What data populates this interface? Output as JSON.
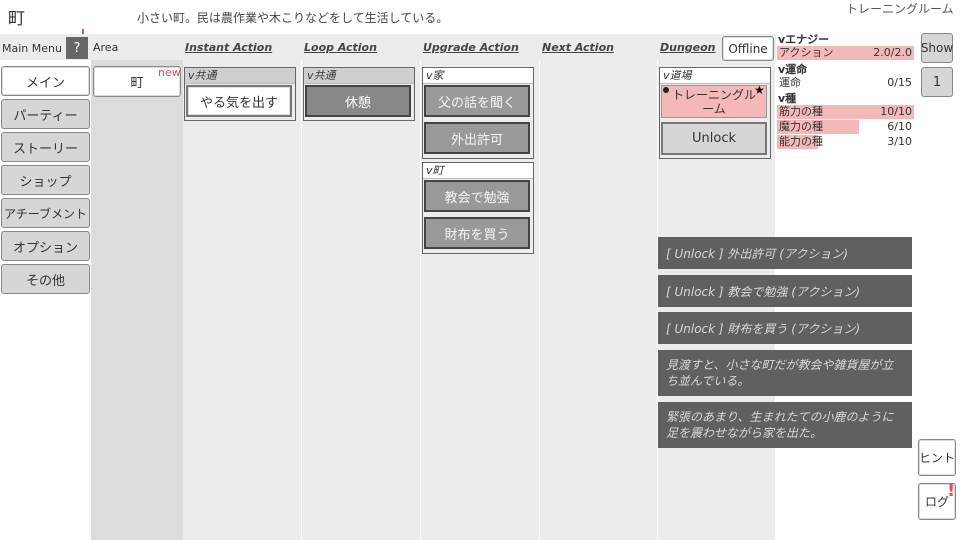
{
  "header": {
    "location": "町",
    "description": "小さい町。民は農作業や木こりなどをして生活している。",
    "current_area": "トレーニングルーム"
  },
  "columns": {
    "main_menu": "Main Menu",
    "help": "?",
    "area": "Area",
    "instant": "Instant Action",
    "loop": "Loop Action",
    "upgrade": "Upgrade Action",
    "next": "Next Action",
    "dungeon": "Dungeon",
    "offline": "Offline"
  },
  "menu": [
    "メイン",
    "パーティー",
    "ストーリー",
    "ショップ",
    "アチーブメント",
    "オプション",
    "その他"
  ],
  "area": {
    "town": "町",
    "new_badge": "new"
  },
  "instant": {
    "group": "共通",
    "items": [
      "やる気を出す"
    ]
  },
  "loop": {
    "group": "共通",
    "items": [
      "休憩"
    ]
  },
  "upgrade": {
    "home_group": "家",
    "home_items": [
      "父の話を聞く",
      "外出許可"
    ],
    "town_group": "町",
    "town_items": [
      "教会で勉強",
      "財布を買う"
    ]
  },
  "dungeon": {
    "group": "道場",
    "item": "トレーニングルーム",
    "unlock": "Unlock"
  },
  "stats": {
    "energy_head": "エナジー",
    "energy_rows": [
      {
        "label": "アクション",
        "value": "2.0/2.0",
        "fill": 1.0
      }
    ],
    "fate_head": "運命",
    "fate_rows": [
      {
        "label": "運命",
        "value": "0/15",
        "fill": 0.0
      }
    ],
    "seed_head": "種",
    "seed_rows": [
      {
        "label": "筋力の種",
        "value": "10/10",
        "fill": 1.0
      },
      {
        "label": "魔力の種",
        "value": "6/10",
        "fill": 0.6
      },
      {
        "label": "能力の種",
        "value": "3/10",
        "fill": 0.3
      }
    ]
  },
  "side": {
    "show": "Show",
    "page": "1",
    "hint": "ヒント",
    "log": "ログ",
    "log_badge": "!"
  },
  "messages": [
    "[ Unlock ] 外出許可 (アクション)",
    "[ Unlock ] 教会で勉強 (アクション)",
    "[ Unlock ] 財布を買う (アクション)",
    "見渡すと、小さな町だが教会や雑貨屋が立ち並んでいる。",
    "緊張のあまり、生まれたての小鹿のように足を震わせながら家を出た。"
  ],
  "colors": {
    "accent_red": "#e05050",
    "bar_fill": "#f4b8b8",
    "message_bg": "#606060"
  }
}
